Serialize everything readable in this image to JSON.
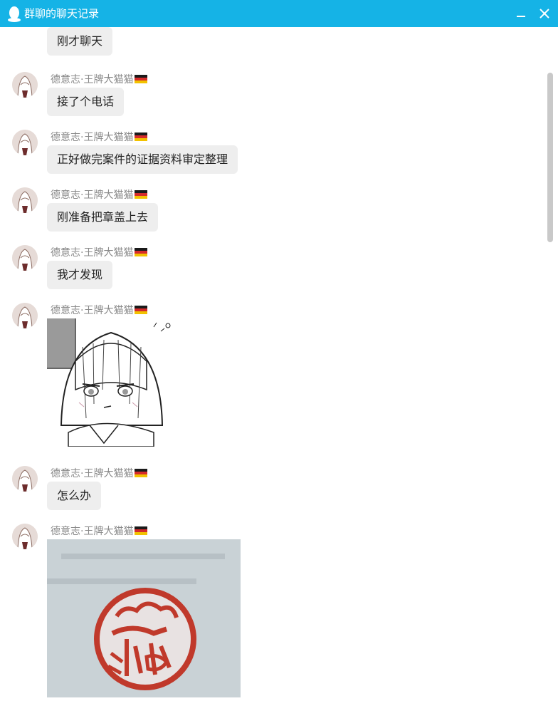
{
  "window": {
    "title": "群聊的聊天记录",
    "accent": "#15b3e6"
  },
  "icons": {
    "app": "qq-penguin-icon",
    "minimize": "minimize-icon",
    "close": "close-icon",
    "flag": "germany-flag-icon"
  },
  "messages": [
    {
      "type": "text",
      "text": "刚才聊天"
    },
    {
      "type": "text",
      "sender": "德意志·王牌大猫猫",
      "text": "接了个电话"
    },
    {
      "type": "text",
      "sender": "德意志·王牌大猫猫",
      "text": "正好做完案件的证据资料审定整理"
    },
    {
      "type": "text",
      "sender": "德意志·王牌大猫猫",
      "text": "刚准备把章盖上去"
    },
    {
      "type": "text",
      "sender": "德意志·王牌大猫猫",
      "text": "我才发现"
    },
    {
      "type": "image",
      "sender": "德意志·王牌大猫猫",
      "image": "manga-girl-sticker"
    },
    {
      "type": "text",
      "sender": "德意志·王牌大猫猫",
      "text": "怎么办"
    },
    {
      "type": "image",
      "sender": "德意志·王牌大猫猫",
      "image": "red-anime-seal-stamp-photo"
    }
  ]
}
